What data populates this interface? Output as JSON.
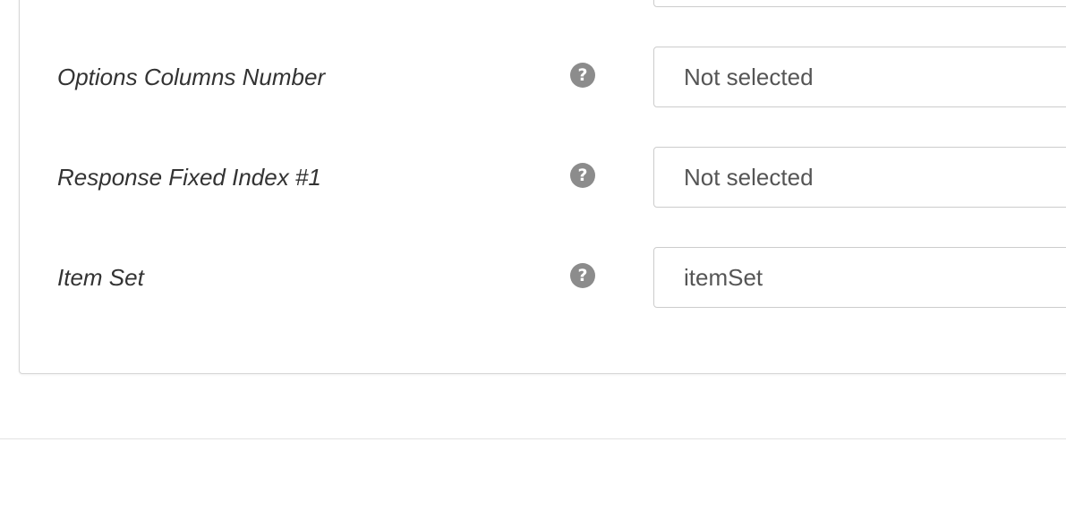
{
  "form": {
    "fields": [
      {
        "label": "Options Columns Number",
        "value": "Not selected",
        "help_icon": "question-circle-icon"
      },
      {
        "label": "Response Fixed Index #1",
        "value": "Not selected",
        "help_icon": "question-circle-icon"
      },
      {
        "label": "Item Set",
        "value": "itemSet",
        "help_icon": "question-circle-icon"
      }
    ],
    "help_glyph": "?"
  },
  "colors": {
    "label_text": "#333333",
    "value_text": "#555555",
    "icon_bg": "#8c8c8c",
    "border": "#cccccc"
  }
}
